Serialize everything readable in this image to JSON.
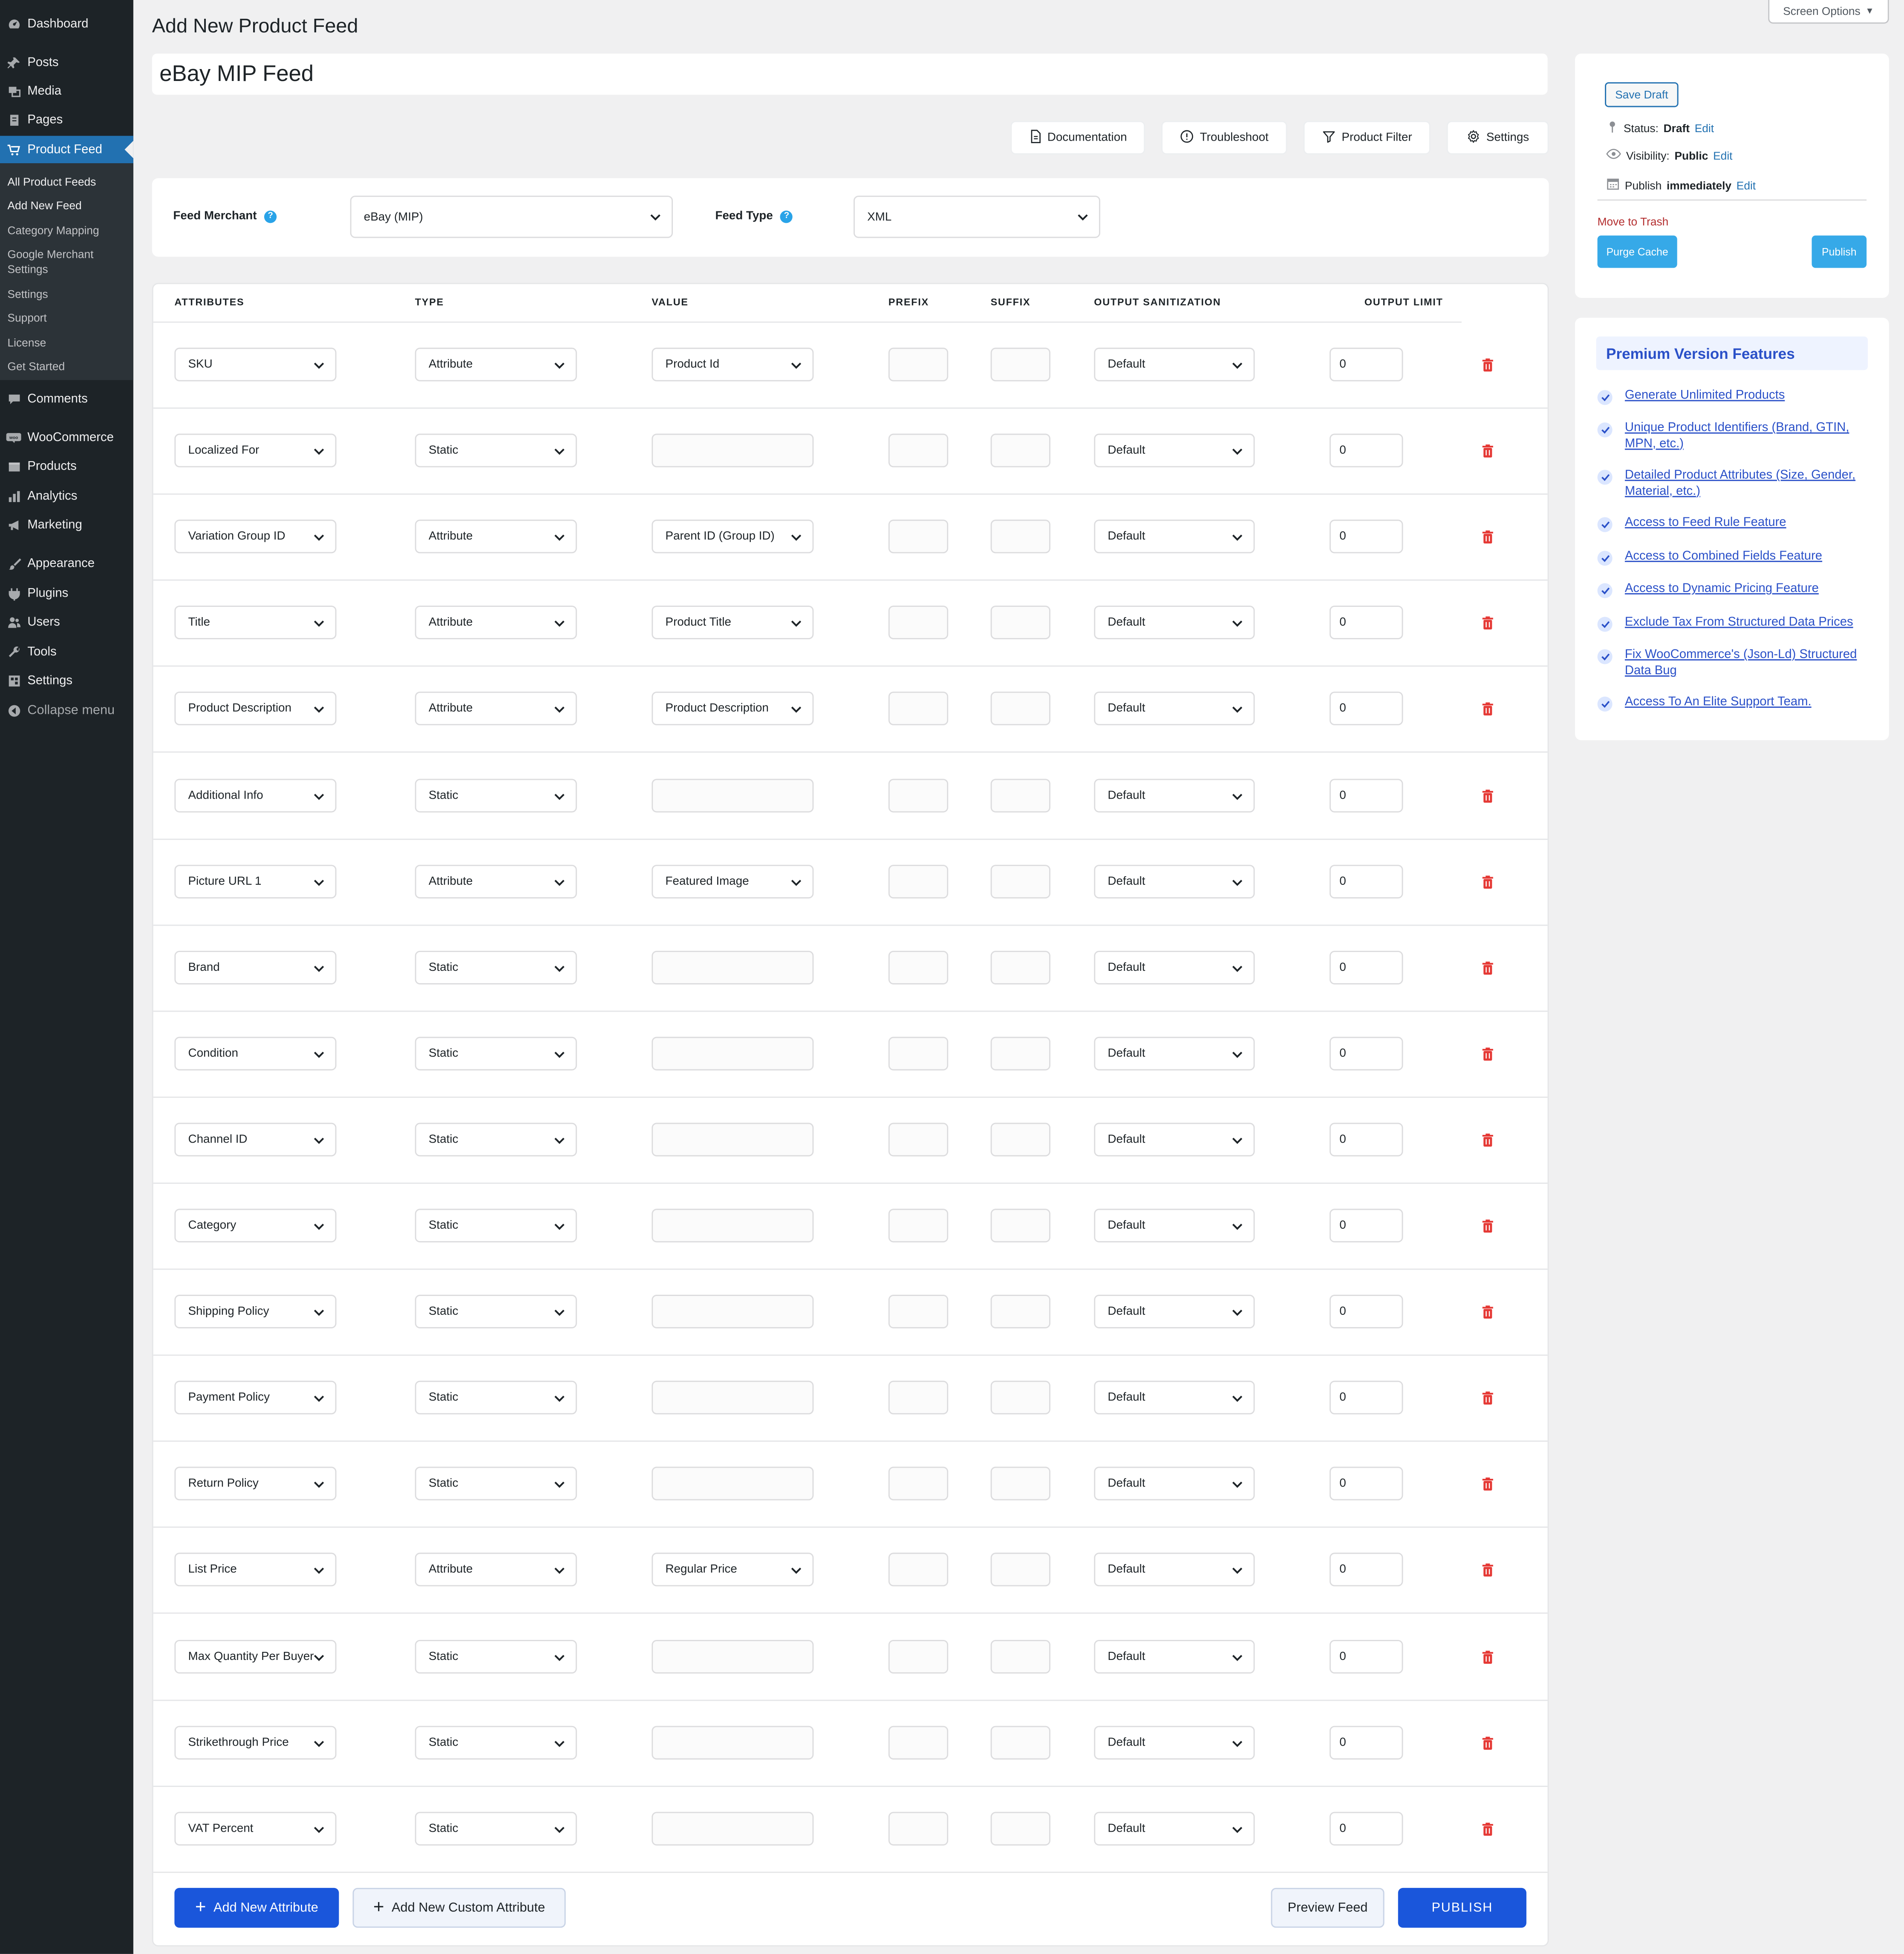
{
  "sidebar": {
    "items": [
      {
        "label": "Dashboard",
        "icon": "dashboard-icon"
      },
      {
        "label": "Posts",
        "icon": "pin-icon"
      },
      {
        "label": "Media",
        "icon": "media-icon"
      },
      {
        "label": "Pages",
        "icon": "pages-icon"
      },
      {
        "label": "Product Feed",
        "icon": "cart-icon"
      },
      {
        "label": "Comments",
        "icon": "comment-icon"
      },
      {
        "label": "WooCommerce",
        "icon": "woo-icon"
      },
      {
        "label": "Products",
        "icon": "box-icon"
      },
      {
        "label": "Analytics",
        "icon": "bar-chart-icon"
      },
      {
        "label": "Marketing",
        "icon": "megaphone-icon"
      },
      {
        "label": "Appearance",
        "icon": "brush-icon"
      },
      {
        "label": "Plugins",
        "icon": "plug-icon"
      },
      {
        "label": "Users",
        "icon": "users-icon"
      },
      {
        "label": "Tools",
        "icon": "wrench-icon"
      },
      {
        "label": "Settings",
        "icon": "settings-icon"
      },
      {
        "label": "Collapse menu",
        "icon": "collapse-icon"
      }
    ],
    "submenu": [
      "All Product Feeds",
      "Add New Feed",
      "Category Mapping",
      "Google Merchant Settings",
      "Settings",
      "Support",
      "License",
      "Get Started"
    ]
  },
  "screen_options": "Screen Options",
  "page_title": "Add New Product Feed",
  "feed_title": "eBay MIP Feed",
  "toolbar": {
    "documentation": "Documentation",
    "troubleshoot": "Troubleshoot",
    "product_filter": "Product Filter",
    "settings": "Settings"
  },
  "merchant": {
    "feed_merchant_label": "Feed Merchant",
    "feed_merchant_value": "eBay (MIP)",
    "feed_type_label": "Feed Type",
    "feed_type_value": "XML"
  },
  "table": {
    "headers": [
      "ATTRIBUTES",
      "TYPE",
      "VALUE",
      "PREFIX",
      "SUFFIX",
      "OUTPUT SANITIZATION",
      "OUTPUT LIMIT"
    ],
    "rows": [
      {
        "attribute": "SKU",
        "type": "Attribute",
        "value": "Product Id",
        "sanitization": "Default",
        "limit": "0"
      },
      {
        "attribute": "Localized For",
        "type": "Static",
        "value": "",
        "sanitization": "Default",
        "limit": "0"
      },
      {
        "attribute": "Variation Group ID",
        "type": "Attribute",
        "value": "Parent ID (Group ID)",
        "sanitization": "Default",
        "limit": "0"
      },
      {
        "attribute": "Title",
        "type": "Attribute",
        "value": "Product Title",
        "sanitization": "Default",
        "limit": "0"
      },
      {
        "attribute": "Product Description",
        "type": "Attribute",
        "value": "Product Description",
        "sanitization": "Default",
        "limit": "0"
      },
      {
        "attribute": "Additional Info",
        "type": "Static",
        "value": "",
        "sanitization": "Default",
        "limit": "0"
      },
      {
        "attribute": "Picture URL 1",
        "type": "Attribute",
        "value": "Featured Image",
        "sanitization": "Default",
        "limit": "0"
      },
      {
        "attribute": "Brand",
        "type": "Static",
        "value": "",
        "sanitization": "Default",
        "limit": "0"
      },
      {
        "attribute": "Condition",
        "type": "Static",
        "value": "",
        "sanitization": "Default",
        "limit": "0"
      },
      {
        "attribute": "Channel ID",
        "type": "Static",
        "value": "",
        "sanitization": "Default",
        "limit": "0"
      },
      {
        "attribute": "Category",
        "type": "Static",
        "value": "",
        "sanitization": "Default",
        "limit": "0"
      },
      {
        "attribute": "Shipping Policy",
        "type": "Static",
        "value": "",
        "sanitization": "Default",
        "limit": "0"
      },
      {
        "attribute": "Payment Policy",
        "type": "Static",
        "value": "",
        "sanitization": "Default",
        "limit": "0"
      },
      {
        "attribute": "Return Policy",
        "type": "Static",
        "value": "",
        "sanitization": "Default",
        "limit": "0"
      },
      {
        "attribute": "List Price",
        "type": "Attribute",
        "value": "Regular Price",
        "sanitization": "Default",
        "limit": "0"
      },
      {
        "attribute": "Max Quantity Per Buyer",
        "type": "Static",
        "value": "",
        "sanitization": "Default",
        "limit": "0"
      },
      {
        "attribute": "Strikethrough Price",
        "type": "Static",
        "value": "",
        "sanitization": "Default",
        "limit": "0"
      },
      {
        "attribute": "VAT Percent",
        "type": "Static",
        "value": "",
        "sanitization": "Default",
        "limit": "0"
      }
    ]
  },
  "footer": {
    "add_attribute": "Add New Attribute",
    "add_custom": "Add New Custom Attribute",
    "preview": "Preview Feed",
    "publish": "PUBLISH"
  },
  "publish_box": {
    "save_draft": "Save Draft",
    "status_label": "Status:",
    "status_value": "Draft",
    "visibility_label": "Visibility:",
    "visibility_value": "Public",
    "publish_label": "Publish",
    "publish_value": "immediately",
    "edit": "Edit",
    "trash": "Move to Trash",
    "purge": "Purge Cache",
    "publish": "Publish"
  },
  "premium": {
    "title": "Premium Version Features",
    "items": [
      "Generate Unlimited Products",
      "Unique Product Identifiers (Brand, GTIN, MPN, etc.)",
      "Detailed Product Attributes (Size, Gender, Material, etc.)",
      "Access to Feed Rule Feature",
      "Access to Combined Fields Feature",
      "Access to Dynamic Pricing Feature",
      "Exclude Tax From Structured Data Prices",
      "Fix WooCommerce's (Json-Ld) Structured Data Bug",
      "Access To An Elite Support Team."
    ]
  },
  "colors": {
    "sidebar": "#1d2327",
    "accent": "#2271b1",
    "primary_button": "#1a56db",
    "cyan_button": "#36a9e8",
    "trash": "#e53935"
  }
}
